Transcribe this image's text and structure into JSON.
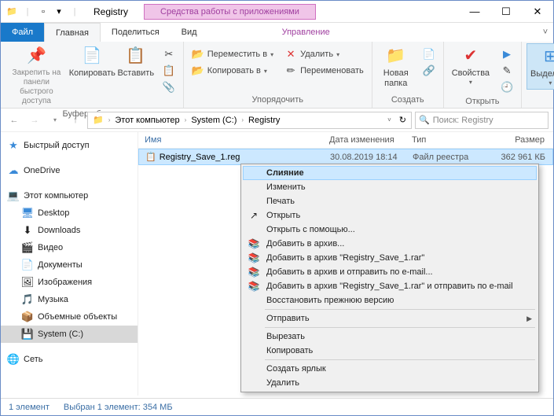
{
  "window": {
    "title": "Registry",
    "apptools": "Средства работы с приложениями"
  },
  "tabs": {
    "file": "Файл",
    "home": "Главная",
    "share": "Поделиться",
    "view": "Вид",
    "manage": "Управление"
  },
  "ribbon": {
    "clipboard": {
      "label": "Буфер обмена",
      "pin": "Закрепить на панели\nбыстрого доступа",
      "copy": "Копировать",
      "paste": "Вставить"
    },
    "organize": {
      "label": "Упорядочить",
      "moveto": "Переместить в",
      "copyto": "Копировать в",
      "del": "Удалить",
      "rename": "Переименовать"
    },
    "new": {
      "label": "Создать",
      "newfolder": "Новая\nпапка"
    },
    "open": {
      "label": "Открыть",
      "props": "Свойства"
    },
    "select": {
      "label": "",
      "select": "Выделить"
    }
  },
  "breadcrumb": {
    "pc": "Этот компьютер",
    "drive": "System (C:)",
    "folder": "Registry"
  },
  "search": {
    "placeholder": "Поиск: Registry"
  },
  "columns": {
    "name": "Имя",
    "date": "Дата изменения",
    "type": "Тип",
    "size": "Размер"
  },
  "sidebar": {
    "quick": "Быстрый доступ",
    "onedrive": "OneDrive",
    "thispc": "Этот компьютер",
    "desktop": "Desktop",
    "downloads": "Downloads",
    "videos": "Видео",
    "documents": "Документы",
    "pictures": "Изображения",
    "music": "Музыка",
    "volumes": "Объемные объекты",
    "systemc": "System (C:)",
    "network": "Сеть"
  },
  "file": {
    "name": "Registry_Save_1.reg",
    "date": "30.08.2019 18:14",
    "type": "Файл реестра",
    "size": "362 961 КБ"
  },
  "context": {
    "merge": "Слияние",
    "edit": "Изменить",
    "print": "Печать",
    "open": "Открыть",
    "openwith": "Открыть с помощью...",
    "addarchive": "Добавить в архив...",
    "addrar": "Добавить в архив \"Registry_Save_1.rar\"",
    "addemail": "Добавить в архив и отправить по e-mail...",
    "addraremail": "Добавить в архив \"Registry_Save_1.rar\" и отправить по e-mail",
    "restore": "Восстановить прежнюю версию",
    "sendto": "Отправить",
    "cut": "Вырезать",
    "copy": "Копировать",
    "shortcut": "Создать ярлык",
    "delete": "Удалить"
  },
  "status": {
    "count": "1 элемент",
    "selection": "Выбран 1 элемент: 354 МБ"
  }
}
